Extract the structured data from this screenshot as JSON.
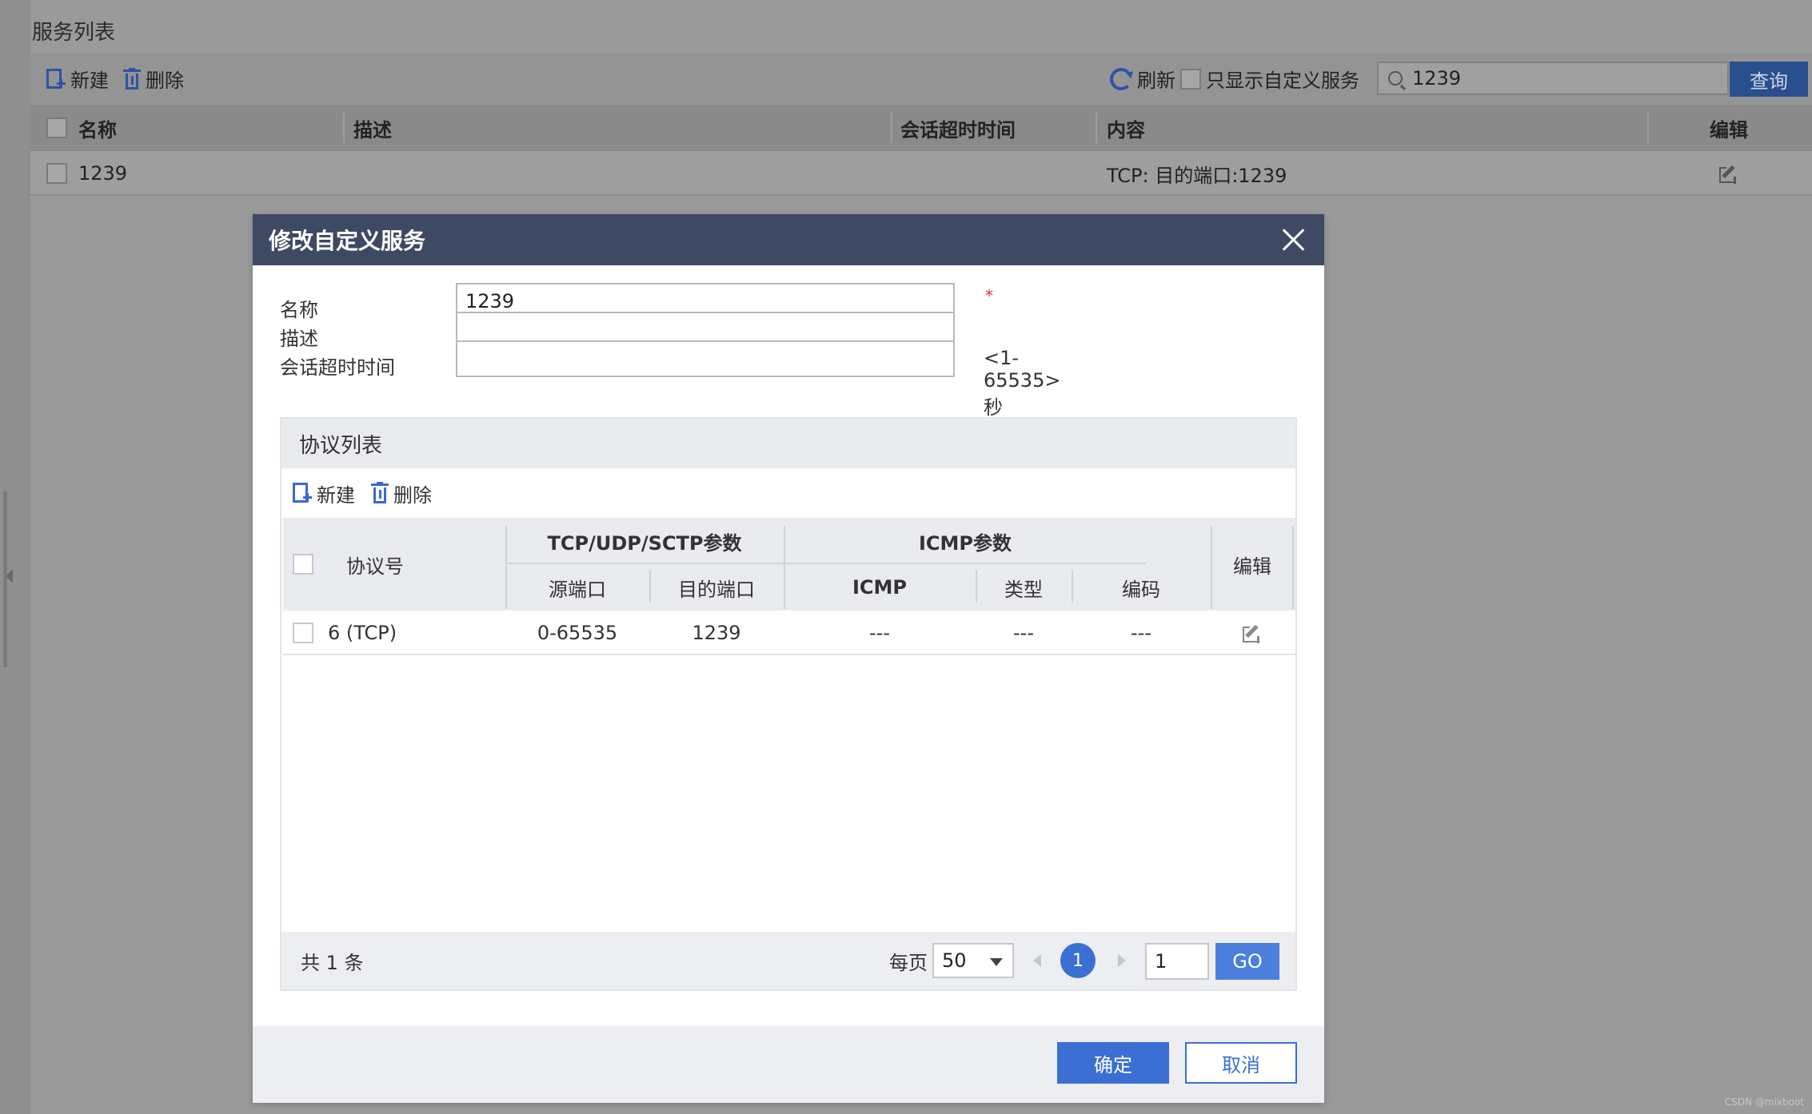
{
  "page": {
    "title": "服务列表",
    "toolbar": {
      "new_label": "新建",
      "delete_label": "删除",
      "refresh_label": "刷新",
      "custom_only_label": "只显示自定义服务",
      "search_value": "1239",
      "search_button": "查询"
    },
    "table": {
      "headers": [
        "名称",
        "描述",
        "会话超时时间",
        "内容",
        "编辑"
      ],
      "rows": [
        {
          "name": "1239",
          "description": "",
          "timeout": "",
          "content": "TCP: 目的端口:1239"
        }
      ]
    }
  },
  "dialog": {
    "title": "修改自定义服务",
    "fields": {
      "name_label": "名称",
      "name_value": "1239",
      "required_mark": "*",
      "desc_label": "描述",
      "desc_value": "",
      "timeout_label": "会话超时时间",
      "timeout_value": "",
      "timeout_hint": "<1-65535>秒"
    },
    "protocol_list": {
      "title": "协议列表",
      "new_label": "新建",
      "delete_label": "删除",
      "headers": {
        "protocol": "协议号",
        "tcp_group": "TCP/UDP/SCTP参数",
        "src_port": "源端口",
        "dst_port": "目的端口",
        "icmp_group": "ICMP参数",
        "icmp": "ICMP",
        "type": "类型",
        "code": "编码",
        "edit": "编辑"
      },
      "rows": [
        {
          "protocol": "6 (TCP)",
          "src_port": "0-65535",
          "dst_port": "1239",
          "icmp": "---",
          "type": "---",
          "code": "---"
        }
      ],
      "pager": {
        "total": "共 1 条",
        "per_page_label": "每页",
        "per_page_value": "50",
        "current_page": "1",
        "goto_value": "1",
        "go_label": "GO"
      }
    },
    "ok_label": "确定",
    "cancel_label": "取消"
  },
  "watermark": "CSDN @mixboot"
}
